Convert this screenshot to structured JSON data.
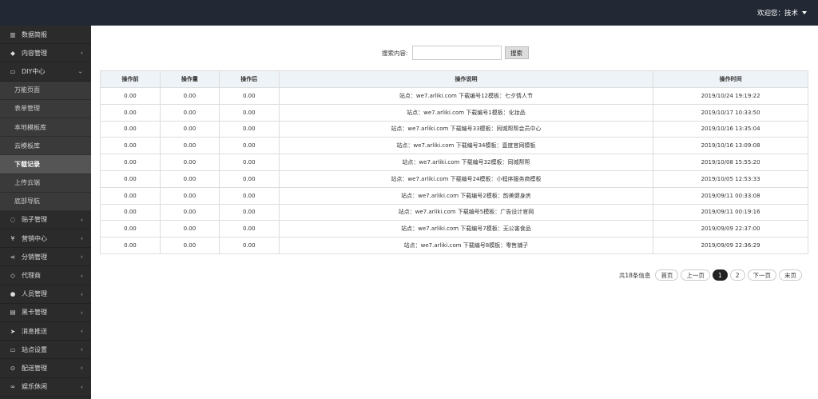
{
  "header": {
    "welcome": "欢迎您：技术"
  },
  "sidebar": {
    "items": [
      {
        "icon": "bar-chart-icon",
        "glyph": "▥",
        "label": "数据简报",
        "arrow": ""
      },
      {
        "icon": "tag-icon",
        "glyph": "◆",
        "label": "内容管理",
        "arrow": "‹"
      },
      {
        "icon": "monitor-icon",
        "glyph": "▭",
        "label": "DIY中心",
        "arrow": "⌄"
      }
    ],
    "sub_items": [
      {
        "label": "万能页面"
      },
      {
        "label": "表单管理"
      },
      {
        "label": "本地模板库"
      },
      {
        "label": "云模板库"
      },
      {
        "label": "下载记录"
      },
      {
        "label": "上传云端"
      },
      {
        "label": "底部导航"
      }
    ],
    "items2": [
      {
        "icon": "comment-icon",
        "glyph": "◌",
        "label": "贴子管理",
        "arrow": "‹"
      },
      {
        "icon": "yen-icon",
        "glyph": "¥",
        "label": "营销中心",
        "arrow": "‹"
      },
      {
        "icon": "share-icon",
        "glyph": "⋖",
        "label": "分销管理",
        "arrow": "‹"
      },
      {
        "icon": "diamond-icon",
        "glyph": "◇",
        "label": "代理商",
        "arrow": "‹"
      },
      {
        "icon": "users-icon",
        "glyph": "●",
        "label": "人员管理",
        "arrow": "‹"
      },
      {
        "icon": "card-icon",
        "glyph": "▤",
        "label": "黑卡管理",
        "arrow": "‹"
      },
      {
        "icon": "send-icon",
        "glyph": "➤",
        "label": "消息推送",
        "arrow": "‹"
      },
      {
        "icon": "desktop-icon",
        "glyph": "▭",
        "label": "站点设置",
        "arrow": "‹"
      },
      {
        "icon": "motorcycle-icon",
        "glyph": "⊙",
        "label": "配送管理",
        "arrow": "‹"
      },
      {
        "icon": "gamepad-icon",
        "glyph": "∞",
        "label": "娱乐休闲",
        "arrow": "‹"
      }
    ]
  },
  "search": {
    "label": "搜索内容:",
    "value": "",
    "button": "搜索"
  },
  "table": {
    "headers": [
      "操作前",
      "操作量",
      "操作后",
      "操作说明",
      "操作时间"
    ],
    "rows": [
      [
        "0.00",
        "0.00",
        "0.00",
        "站点：we7.arliki.com 下载编号12模板：七夕情人节",
        "2019/10/24 19:19:22"
      ],
      [
        "0.00",
        "0.00",
        "0.00",
        "站点：we7.arliki.com 下载编号1模板：化妆品",
        "2019/10/17 10:33:50"
      ],
      [
        "0.00",
        "0.00",
        "0.00",
        "站点：we7.arliki.com 下载编号33模板：同城帮帮会员中心",
        "2019/10/16 13:35:04"
      ],
      [
        "0.00",
        "0.00",
        "0.00",
        "站点：we7.arliki.com 下载编号34模板：壹度官网模板",
        "2019/10/16 13:09:08"
      ],
      [
        "0.00",
        "0.00",
        "0.00",
        "站点：we7.arliki.com 下载编号32模板：同城帮帮",
        "2019/10/08 15:55:20"
      ],
      [
        "0.00",
        "0.00",
        "0.00",
        "站点：we7.arliki.com 下载编号24模板：小程序服务商模板",
        "2019/10/05 12:53:33"
      ],
      [
        "0.00",
        "0.00",
        "0.00",
        "站点：we7.arliki.com 下载编号2模板：韵美健身房",
        "2019/09/11 00:33:08"
      ],
      [
        "0.00",
        "0.00",
        "0.00",
        "站点：we7.arliki.com 下载编号5模板：广告设计官网",
        "2019/09/11 00:19:16"
      ],
      [
        "0.00",
        "0.00",
        "0.00",
        "站点：we7.arliki.com 下载编号7模板：无公害食品",
        "2019/09/09 22:37:00"
      ],
      [
        "0.00",
        "0.00",
        "0.00",
        "站点：we7.arliki.com 下载编号8模板：零售铺子",
        "2019/09/09 22:36:29"
      ]
    ]
  },
  "pagination": {
    "total": "共18条信息",
    "first": "首页",
    "prev": "上一页",
    "pages": [
      "1",
      "2"
    ],
    "current": "1",
    "next": "下一页",
    "last": "末页"
  }
}
